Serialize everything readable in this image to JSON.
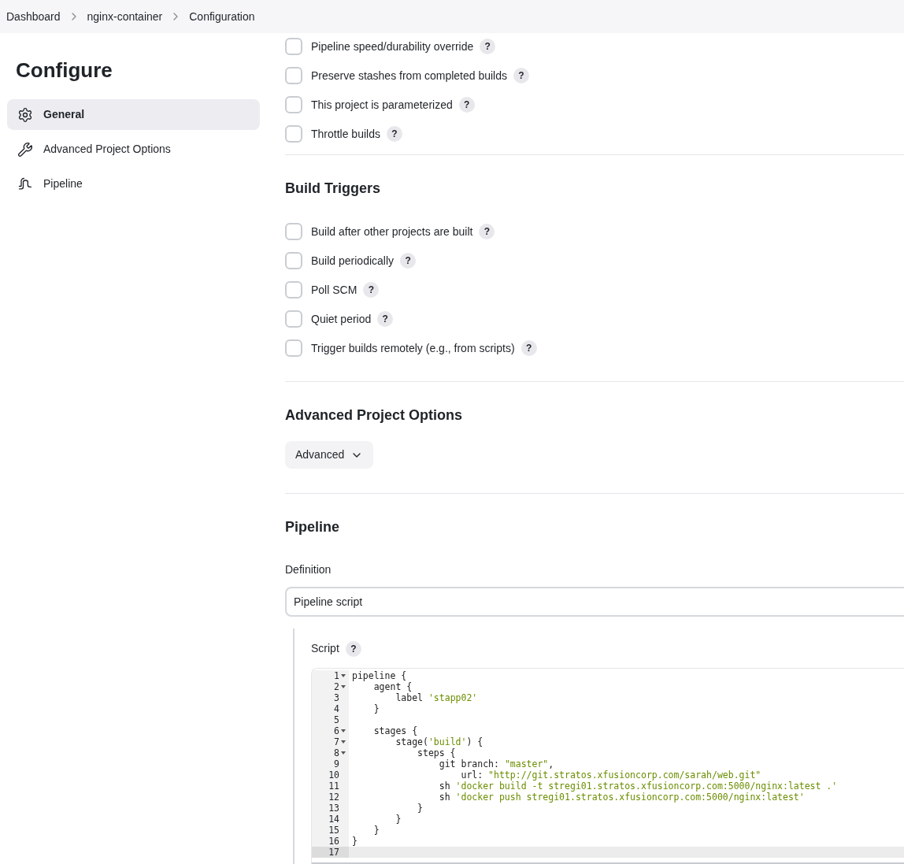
{
  "breadcrumb": [
    {
      "label": "Dashboard"
    },
    {
      "label": "nginx-container"
    },
    {
      "label": "Configuration"
    }
  ],
  "sidebar": {
    "title": "Configure",
    "items": [
      {
        "label": "General",
        "kind": "gear",
        "selected": true
      },
      {
        "label": "Advanced Project Options",
        "kind": "wrench",
        "selected": false
      },
      {
        "label": "Pipeline",
        "kind": "pipe",
        "selected": false
      }
    ]
  },
  "general": {
    "options": [
      {
        "label": "Pipeline speed/durability override",
        "checked": false,
        "help": "?"
      },
      {
        "label": "Preserve stashes from completed builds",
        "checked": false,
        "help": "?"
      },
      {
        "label": "This project is parameterized",
        "checked": false,
        "help": "?"
      },
      {
        "label": "Throttle builds",
        "checked": false,
        "help": "?"
      }
    ]
  },
  "build_triggers": {
    "heading": "Build Triggers",
    "options": [
      {
        "label": "Build after other projects are built",
        "checked": false,
        "help": "?"
      },
      {
        "label": "Build periodically",
        "checked": false,
        "help": "?"
      },
      {
        "label": "Poll SCM",
        "checked": false,
        "help": "?"
      },
      {
        "label": "Quiet period",
        "checked": false,
        "help": "?"
      },
      {
        "label": "Trigger builds remotely (e.g., from scripts)",
        "checked": false,
        "help": "?"
      }
    ]
  },
  "advanced": {
    "heading": "Advanced Project Options",
    "button": "Advanced"
  },
  "pipeline": {
    "heading": "Pipeline",
    "definition": {
      "label": "Definition",
      "value": "Pipeline script"
    },
    "script": {
      "label": "Script",
      "help": "?",
      "lines": [
        {
          "number": "1",
          "foldable": true,
          "selected": false,
          "tokens": [
            {
              "text": "pipeline {",
              "kind": "plain"
            }
          ]
        },
        {
          "number": "2",
          "foldable": true,
          "selected": false,
          "tokens": [
            {
              "text": "    agent {",
              "kind": "plain"
            }
          ]
        },
        {
          "number": "3",
          "foldable": false,
          "selected": false,
          "tokens": [
            {
              "text": "        label ",
              "kind": "plain"
            },
            {
              "text": "'stapp02'",
              "kind": "string"
            }
          ]
        },
        {
          "number": "4",
          "foldable": false,
          "selected": false,
          "tokens": [
            {
              "text": "    }",
              "kind": "plain"
            }
          ]
        },
        {
          "number": "5",
          "foldable": false,
          "selected": false
        },
        {
          "number": "6",
          "foldable": true,
          "selected": false,
          "tokens": [
            {
              "text": "    stages {",
              "kind": "plain"
            }
          ]
        },
        {
          "number": "7",
          "foldable": true,
          "selected": false,
          "tokens": [
            {
              "text": "        stage(",
              "kind": "plain"
            },
            {
              "text": "'build'",
              "kind": "string"
            },
            {
              "text": ") {",
              "kind": "plain"
            }
          ]
        },
        {
          "number": "8",
          "foldable": true,
          "selected": false,
          "tokens": [
            {
              "text": "            steps {",
              "kind": "plain"
            }
          ]
        },
        {
          "number": "9",
          "foldable": false,
          "selected": false,
          "tokens": [
            {
              "text": "                git branch: ",
              "kind": "plain"
            },
            {
              "text": "\"master\"",
              "kind": "string"
            },
            {
              "text": ",",
              "kind": "plain"
            }
          ]
        },
        {
          "number": "10",
          "foldable": false,
          "selected": false,
          "tokens": [
            {
              "text": "                    url: ",
              "kind": "plain"
            },
            {
              "text": "\"http://git.stratos.xfusioncorp.com/sarah/web.git\"",
              "kind": "string"
            }
          ]
        },
        {
          "number": "11",
          "foldable": false,
          "selected": false,
          "tokens": [
            {
              "text": "                sh ",
              "kind": "plain"
            },
            {
              "text": "'docker build -t stregi01.stratos.xfusioncorp.com:5000/nginx:latest .'",
              "kind": "string"
            }
          ]
        },
        {
          "number": "12",
          "foldable": false,
          "selected": false,
          "tokens": [
            {
              "text": "                sh ",
              "kind": "plain"
            },
            {
              "text": "'docker push stregi01.stratos.xfusioncorp.com:5000/nginx:latest'",
              "kind": "string"
            }
          ]
        },
        {
          "number": "13",
          "foldable": false,
          "selected": false,
          "tokens": [
            {
              "text": "            }",
              "kind": "plain"
            }
          ]
        },
        {
          "number": "14",
          "foldable": false,
          "selected": false,
          "tokens": [
            {
              "text": "        }",
              "kind": "plain"
            }
          ]
        },
        {
          "number": "15",
          "foldable": false,
          "selected": false,
          "tokens": [
            {
              "text": "    }",
              "kind": "plain"
            }
          ]
        },
        {
          "number": "16",
          "foldable": false,
          "selected": false,
          "tokens": [
            {
              "text": "}",
              "kind": "plain"
            }
          ]
        },
        {
          "number": "17",
          "foldable": false,
          "selected": true
        }
      ]
    }
  }
}
